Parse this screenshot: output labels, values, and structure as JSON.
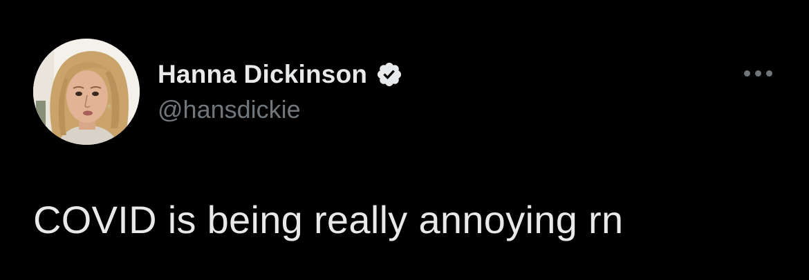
{
  "tweet": {
    "author": {
      "display_name": "Hanna Dickinson",
      "handle": "@hansdickie",
      "verified": true,
      "avatar_icon": "profile-photo"
    },
    "more_icon": "more-horizontal-icon",
    "text": "COVID is being really annoying rn"
  },
  "colors": {
    "background": "#000000",
    "primary_text": "#e7e9ea",
    "secondary_text": "#71767b",
    "verified_badge": "#e7e9ea"
  }
}
